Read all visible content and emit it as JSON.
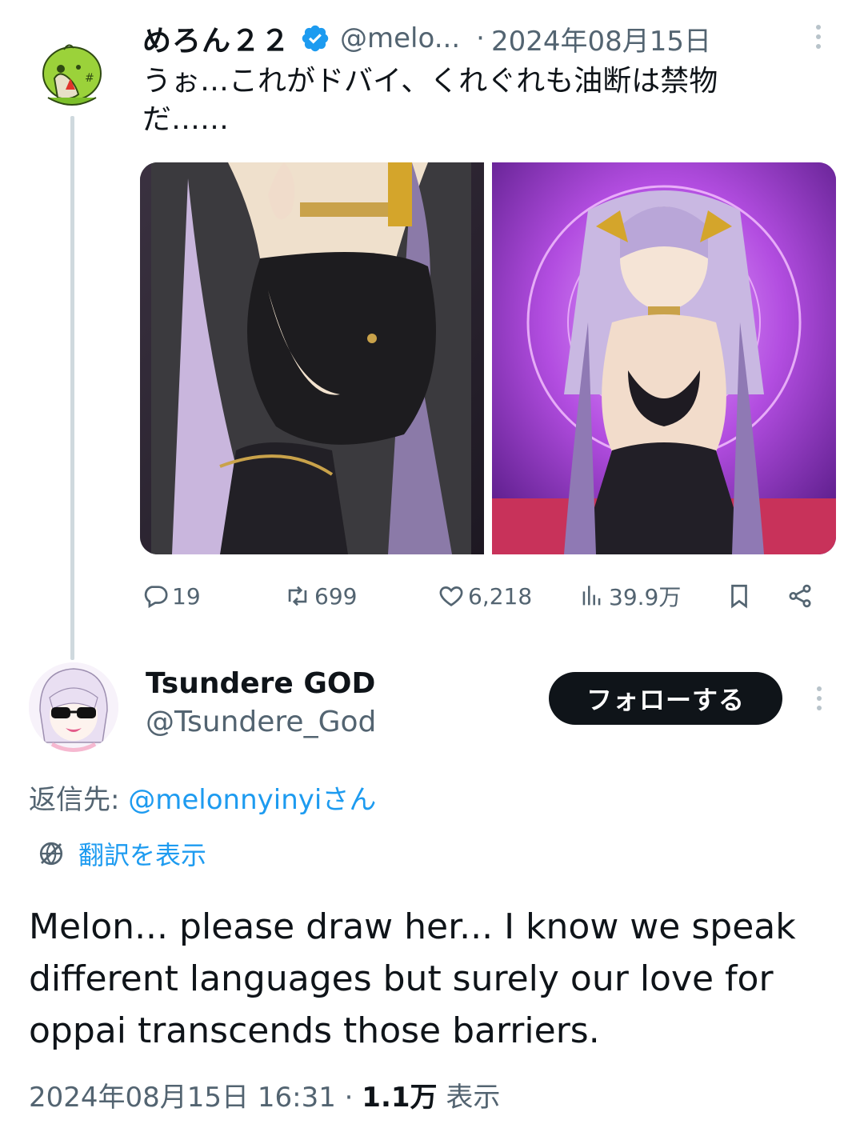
{
  "parent_tweet": {
    "author_name": "めろん２２",
    "handle": "@melo...",
    "separator": "·",
    "date": "2024年08月15日",
    "text_line1": "うぉ…これがドバイ、くれぐれも油断は禁物",
    "text_line2": "だ……",
    "stats": {
      "replies": "19",
      "reposts": "699",
      "likes": "6,218",
      "views": "39.9万"
    }
  },
  "reply_tweet": {
    "author_name": "Tsundere GOD",
    "handle": "@Tsundere_God",
    "follow_label": "フォローする",
    "reply_to_prefix": "返信先: ",
    "reply_to_mention": "@melonnyinyiさん",
    "translate_label": "翻訳を表示",
    "text": "Melon... please draw her... I know we speak different languages but surely our love for oppai transcends those barriers.",
    "timestamp": "2024年08月15日 16:31",
    "separator": " · ",
    "views_count": "1.1万",
    "views_label": " 表示"
  },
  "colors": {
    "accent": "#1d9bf0",
    "text_primary": "#0f1419",
    "text_secondary": "#536471",
    "thread_line": "#cfd9de"
  },
  "icons": [
    "verified-badge-icon",
    "reply-icon",
    "repost-icon",
    "like-icon",
    "views-icon",
    "bookmark-icon",
    "share-icon",
    "translate-globe-icon",
    "more-icon"
  ]
}
